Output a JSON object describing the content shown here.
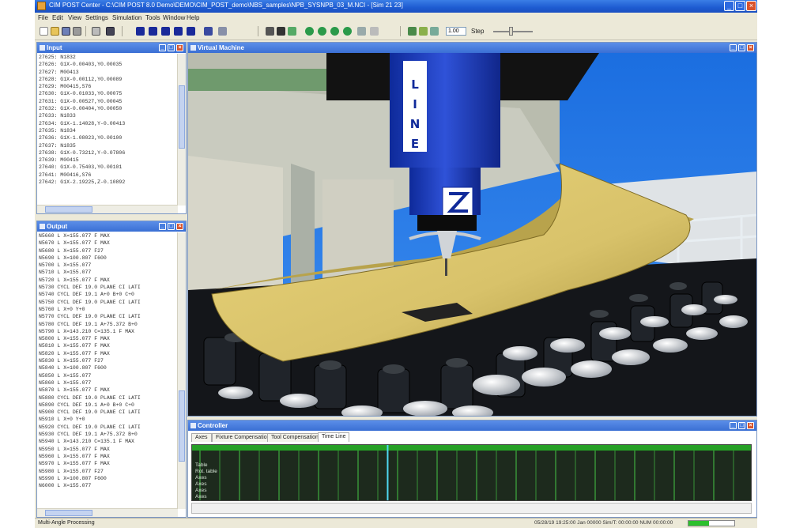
{
  "window": {
    "title": "CIM POST Center - C:\\CIM POST 8.0 Demo\\DEMO\\CIM_POST_demo\\NBS_samples\\NPB_SYSNPB_03_M.NCI - [Sim 21 23]",
    "controls": [
      "_",
      "□",
      "×"
    ]
  },
  "menu": [
    "File",
    "Edit",
    "View",
    "Settings",
    "Simulation",
    "Tools",
    "Window",
    "Help"
  ],
  "toolbar": {
    "zoom_value": "1.00",
    "zoom_label": "Step",
    "zoom_level": 0.4,
    "icons": [
      "new-icon",
      "open-icon",
      "save-icon",
      "print-icon",
      "cut-icon",
      "copy-icon",
      "play-icon",
      "pause-icon",
      "stop-icon",
      "step-icon",
      "rewind-icon",
      "fast-forward-icon",
      "view-icon",
      "machine-icon",
      "tool-icon",
      "green-arrow-icon"
    ]
  },
  "input_panel": {
    "title": "Input",
    "lines": [
      "27625: N1832",
      "27626: G1X-0.00403,Y0.00035",
      "27627: M00413",
      "27628: G1X-0.00112,Y0.00089",
      "27629: M00415,S76",
      "27630: G1X-0.01033,Y0.00075",
      "27631: G1X-0.00527,Y0.00045",
      "27632: G1X-0.00404,Y0.00050",
      "27633: N1833",
      "27634: G1X-1.14028,Y-0.00413",
      "27635: N1834",
      "27636: G1X-1.08023,Y0.00100",
      "27637: N1835",
      "27638: G1X-0.73212,Y-0.07806",
      "27639: M00415",
      "27640: G1X-0.75403,Y0.00101",
      "27641: M00416,S76",
      "27642: G1X-2.19225,Z-0.10892"
    ]
  },
  "output_panel": {
    "title": "Output",
    "lines": [
      "N5660 L X=155.077 F MAX",
      "N5670 L X=155.077 F MAX",
      "N5680 L X=155.077 F27",
      "N5690 L X=100.807 F600",
      "N5700 L X=155.077",
      "N5710 L X=155.077",
      "N5720 L X=155.077 F MAX",
      "N5730 CYCL DEF 19.0 PLANE CI LATI",
      "N5740 CYCL DEF 19.1 A+0 B+0 C+0",
      "N5750 CYCL DEF 19.0 PLANE CI LATI",
      "N5760 L X+0 Y+0",
      "N5770 CYCL DEF 19.0 PLANE CI LATI",
      "N5780 CYCL DEF 19.1 A+75.372 B+0",
      "N5790 L X=143.210 C=135.1 F MAX",
      "N5800 L X=155.077 F MAX",
      "N5810 L X=155.077 F MAX",
      "N5820 L X=155.077 F MAX",
      "N5830 L X=155.077 F27",
      "N5840 L X=100.807 F600",
      "N5850 L X=155.077",
      "N5860 L X=155.077",
      "N5870 L X=155.077 F MAX",
      "N5880 CYCL DEF 19.0 PLANE CI LATI",
      "N5890 CYCL DEF 19.1 A+0 B+0 C+0",
      "N5900 CYCL DEF 19.0 PLANE CI LATI",
      "N5910 L X+0 Y+0",
      "N5920 CYCL DEF 19.0 PLANE CI LATI",
      "N5930 CYCL DEF 19.1 A+75.372 B+0",
      "N5940 L X=143.210 C=135.1 F MAX",
      "N5950 L X=155.077 F MAX",
      "N5960 L X=155.077 F MAX",
      "N5970 L X=155.077 F MAX",
      "N5980 L X=155.077 F27",
      "N5990 L X=100.807 F600",
      "N6000 L X=155.077"
    ]
  },
  "viewport_panel": {
    "title": "Virtual Machine",
    "spindle_label": "LINE"
  },
  "controller_panel": {
    "title": "Controller",
    "tabs": [
      "Axes",
      "Fixture Compensation",
      "Tool Compensation",
      "Time Line"
    ],
    "active_tab": "Time Line",
    "tracks": [
      "Table",
      "Rot. table",
      "Axes",
      "Axes",
      "Axes",
      "Axes"
    ],
    "timeline_marker": 0.35
  },
  "statusbar": {
    "text": "Multi-Angle Processing",
    "right_text": "05/28/19 19:25:00   Jan 00000   Sim/T: 00:00:00   NUM  00:00:00",
    "progress": 0.45
  },
  "colors": {
    "titlebar": "#1e5bd1",
    "spindle": "#1f3fb7",
    "board": "#d8c26a",
    "sky": "#1b6ee0",
    "timeline_bg": "#1d2a1d",
    "timeline_lines": "#3fae3f",
    "progress": "#2cc02c"
  }
}
